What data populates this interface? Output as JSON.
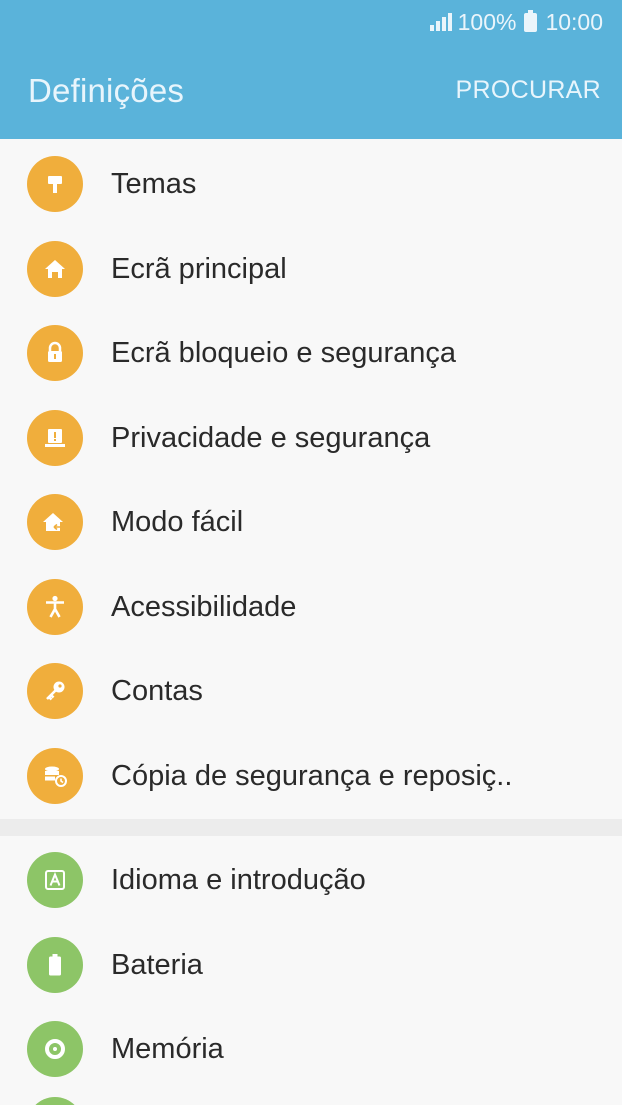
{
  "status": {
    "battery_percent": "100%",
    "time": "10:00"
  },
  "header": {
    "title": "Definições",
    "search_label": "PROCURAR"
  },
  "colors": {
    "header": "#5ab3da",
    "orange_icon": "#f0ae3c",
    "green_icon": "#8dc567"
  },
  "group1": [
    {
      "label": "Temas",
      "icon": "paint-roller-icon"
    },
    {
      "label": "Ecrã principal",
      "icon": "home-icon"
    },
    {
      "label": "Ecrã bloqueio e segurança",
      "icon": "lock-icon"
    },
    {
      "label": "Privacidade e segurança",
      "icon": "privacy-alert-icon"
    },
    {
      "label": "Modo fácil",
      "icon": "easy-mode-home-icon"
    },
    {
      "label": "Acessibilidade",
      "icon": "accessibility-person-icon"
    },
    {
      "label": "Contas",
      "icon": "key-icon"
    },
    {
      "label": "Cópia de segurança e reposiç..",
      "icon": "backup-restore-icon"
    }
  ],
  "group2": [
    {
      "label": "Idioma e introdução",
      "icon": "language-a-icon"
    },
    {
      "label": "Bateria",
      "icon": "battery-icon"
    },
    {
      "label": "Memória",
      "icon": "storage-ring-icon"
    }
  ]
}
